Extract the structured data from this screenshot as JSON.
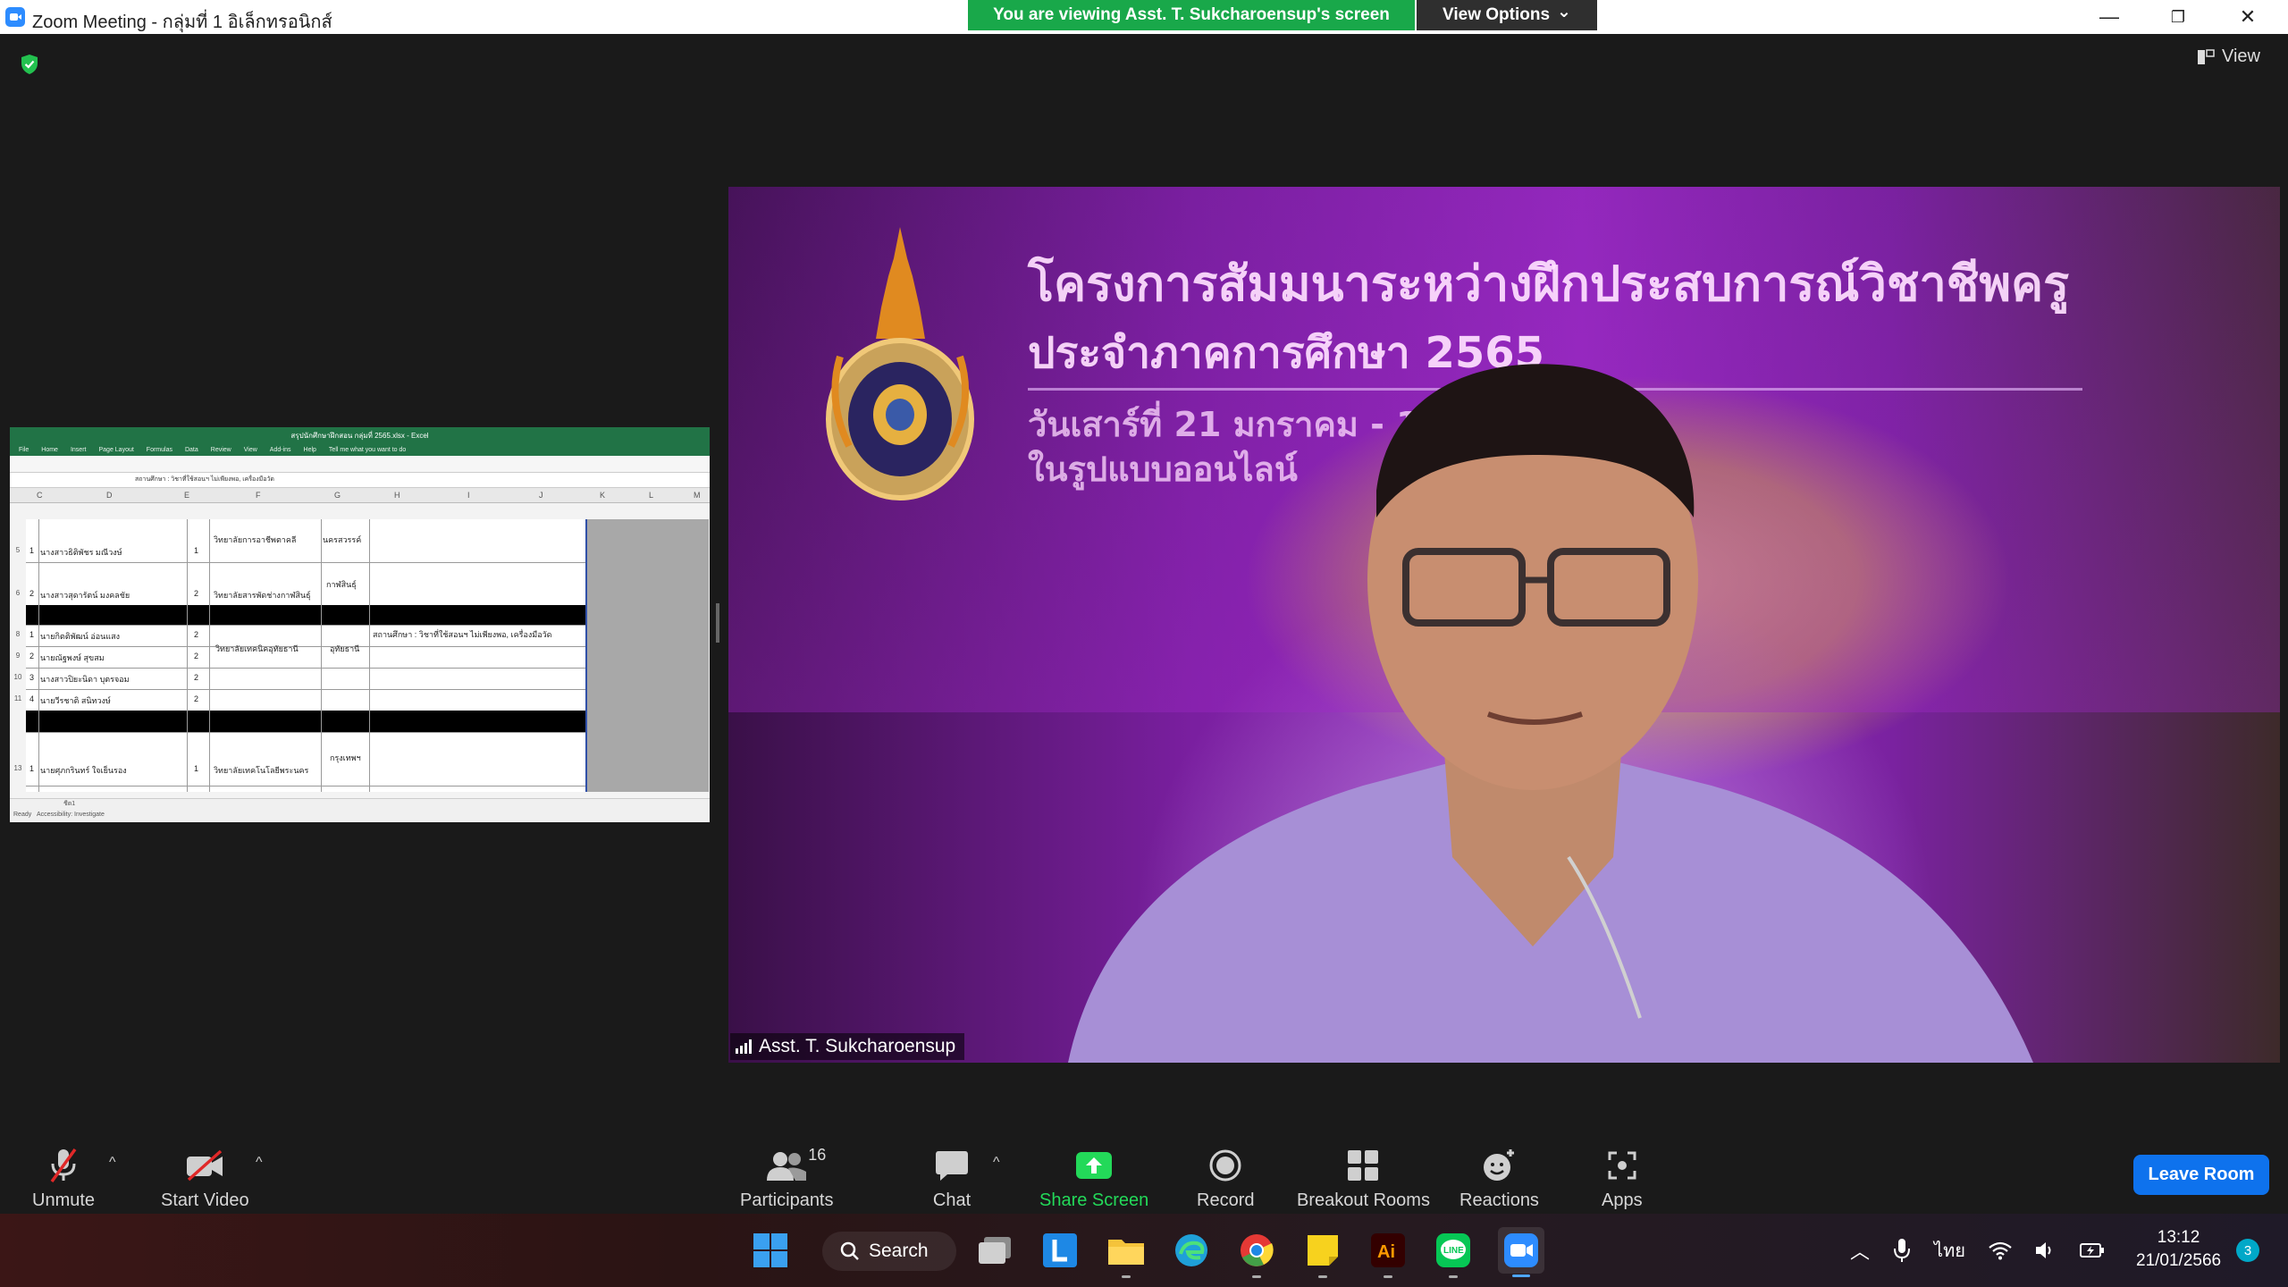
{
  "window": {
    "title": "Zoom Meeting - กลุ่มที่ 1 อิเล็กทรอนิกส์",
    "minimize": "—",
    "restore": "❐",
    "close": "✕"
  },
  "banner": {
    "viewing_text": "You are viewing Asst. T. Sukcharoensup's screen",
    "view_options_label": "View Options",
    "view_options_caret": "⌄"
  },
  "meeting": {
    "view_label": "View"
  },
  "shared_spreadsheet": {
    "title_text": "สรุปนักศึกษาฝึกสอน กลุ่มที่ 2565.xlsx - Excel",
    "menu": [
      "File",
      "Home",
      "Insert",
      "Page Layout",
      "Formulas",
      "Data",
      "Review",
      "View",
      "Add-ins",
      "Help",
      "Tell me what you want to do"
    ],
    "formula_text": "สถานศึกษา : วิชาที่ใช้สอนฯ ไม่เพียงพอ, เครื่องมือวัด",
    "columns": [
      "C",
      "D",
      "E",
      "F",
      "G",
      "H",
      "I",
      "J",
      "K",
      "L",
      "M"
    ],
    "rows": [
      {
        "num": "5",
        "idx": "1",
        "name": "นางสาวธิติพัชร มณีวงษ์",
        "count": "1",
        "school": "วิทยาลัยการอาชีพตาคลี",
        "province": "นครสวรรค์",
        "note": ""
      },
      {
        "num": "6",
        "idx": "2",
        "name": "นางสาวสุดารัตน์ มงคลชัย",
        "count": "2",
        "school": "วิทยาลัยสารพัดช่างกาฬสินธุ์",
        "province": "กาฬสินธุ์",
        "note": ""
      },
      {
        "num": "8",
        "idx": "1",
        "name": "นายกิตติพัฒน์ อ่อนแสง",
        "count": "2",
        "school": "วิทยาลัยเทคนิคอุทัยธานี",
        "province": "อุทัยธานี",
        "note": "สถานศึกษา : วิชาที่ใช้สอนฯ ไม่เพียงพอ, เครื่องมือวัด"
      },
      {
        "num": "9",
        "idx": "2",
        "name": "นายณัฐพงษ์ สุขสม",
        "count": "2",
        "school": "",
        "province": "",
        "note": ""
      },
      {
        "num": "10",
        "idx": "3",
        "name": "นางสาวปิยะนิดา บุตรจอม",
        "count": "2",
        "school": "",
        "province": "",
        "note": ""
      },
      {
        "num": "11",
        "idx": "4",
        "name": "นายวีรชาติ สนิทวงษ์",
        "count": "2",
        "school": "",
        "province": "",
        "note": ""
      },
      {
        "num": "13",
        "idx": "1",
        "name": "นายศุภกรินทร์ ใจเย็นรอง",
        "count": "1",
        "school": "วิทยาลัยเทคโนโลยีพระนคร",
        "province": "กรุงเทพฯ",
        "note": ""
      }
    ],
    "status_left": "Ready",
    "status_accessibility": "Accessibility: Investigate",
    "sheet_tab": "ชีต1"
  },
  "video": {
    "participant_name": "Asst. T. Sukcharoensup",
    "slide_line1": "โครงการสัมมนาระหว่างฝึกประสบการณ์วิชาชีพครู",
    "slide_line2": "ประจำภาคการศึกษา 2565",
    "slide_line3": "วันเสาร์ที่ 21 มกราคม - 16.00 น.",
    "slide_line4": "ในรูปแบบออนไลน์"
  },
  "toolbar": {
    "unmute": "Unmute",
    "start_video": "Start Video",
    "participants": "Participants",
    "participants_count": "16",
    "chat": "Chat",
    "share_screen": "Share Screen",
    "record": "Record",
    "breakout_rooms": "Breakout Rooms",
    "reactions": "Reactions",
    "apps": "Apps",
    "leave_room": "Leave Room",
    "caret": "^"
  },
  "taskbar": {
    "search_label": "Search",
    "language": "ไทย",
    "time": "13:12",
    "date": "21/01/2566",
    "notification_count": "3"
  },
  "colors": {
    "banner_green": "#19a84a",
    "share_green": "#23d959",
    "leave_blue": "#0e72ed",
    "muted_red": "#e02828"
  }
}
